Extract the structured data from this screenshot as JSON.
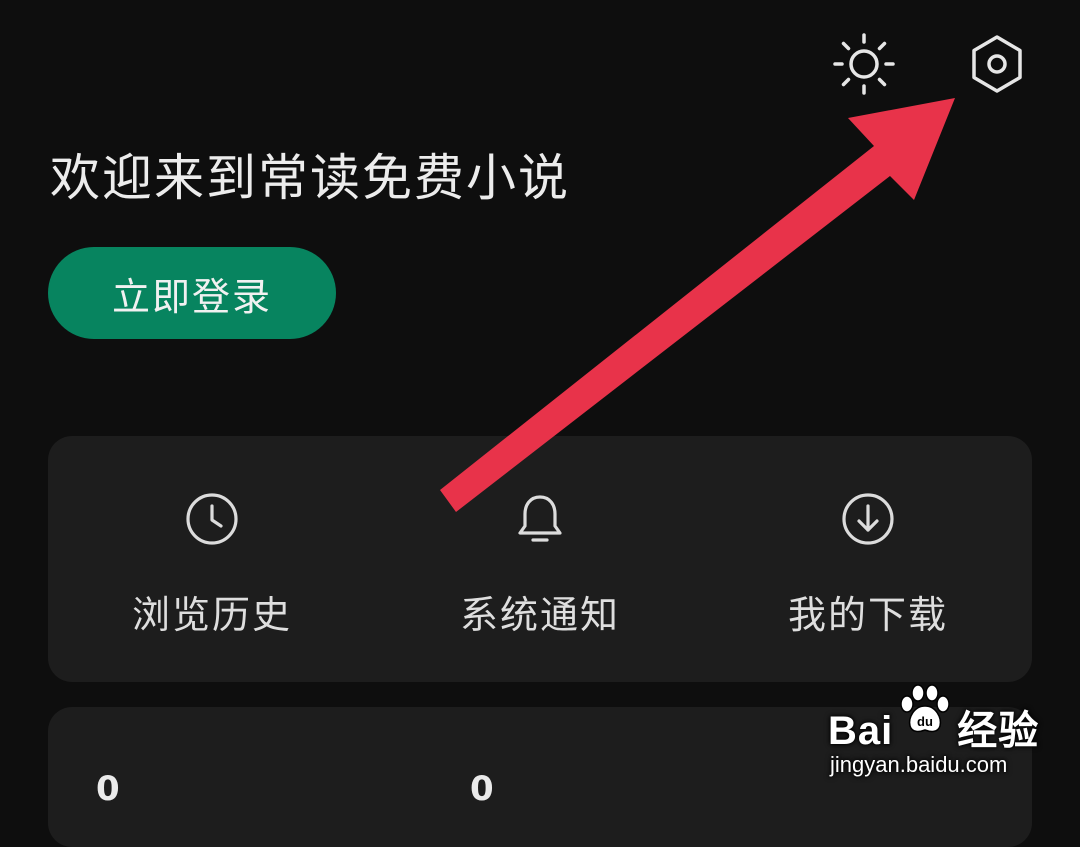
{
  "header": {
    "theme_icon": "sun-icon",
    "settings_icon": "hexagon-gear-icon"
  },
  "welcome_text": "欢迎来到常读免费小说",
  "login_button": "立即登录",
  "quick_actions": [
    {
      "label": "浏览历史",
      "icon": "clock-icon"
    },
    {
      "label": "系统通知",
      "icon": "bell-icon"
    },
    {
      "label": "我的下载",
      "icon": "download-circle-icon"
    }
  ],
  "stats": {
    "values": [
      "0",
      "0"
    ]
  },
  "annotation": {
    "arrow_color": "#e8334a"
  },
  "watermark": {
    "brand_left": "Bai",
    "brand_right": "经验",
    "url": "jingyan.baidu.com"
  },
  "colors": {
    "background": "#0e0e0e",
    "card": "#1d1d1d",
    "accent": "#07845f"
  }
}
